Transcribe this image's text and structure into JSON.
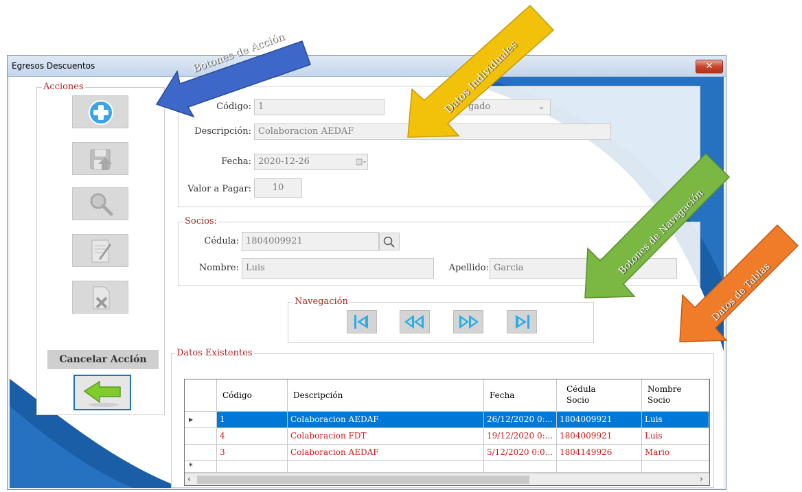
{
  "window": {
    "title": "Egresos Descuentos",
    "close_symbol": "✕"
  },
  "actions": {
    "legend": "Acciones",
    "cancel_label": "Cancelar Acción"
  },
  "form": {
    "codigo_label": "Código:",
    "codigo_value": "1",
    "estado_value": "gado",
    "descripcion_label": "Descripción:",
    "descripcion_value": "Colaboracion AEDAF",
    "fecha_label": "Fecha:",
    "fecha_value": "2020-12-26",
    "valor_label": "Valor a Pagar:",
    "valor_value": "10"
  },
  "socios": {
    "legend": "Socios:",
    "cedula_label": "Cédula:",
    "cedula_value": "1804009921",
    "nombre_label": "Nombre:",
    "nombre_value": "Luis",
    "apellido_label": "Apellido:",
    "apellido_value": "Garcia"
  },
  "navegacion": {
    "legend": "Navegación"
  },
  "datos": {
    "legend": "Datos Existentes",
    "columns": [
      "Código",
      "Descripción",
      "Fecha",
      "Cédula Socio",
      "Nombre Socio"
    ],
    "column_lines": [
      [
        "Código"
      ],
      [
        "Descripción"
      ],
      [
        "Fecha"
      ],
      [
        "Cédula",
        "Socio"
      ],
      [
        "Nombre",
        "Socio"
      ]
    ],
    "rows": [
      {
        "codigo": "1",
        "descripcion": "Colaboracion AEDAF",
        "fecha": "26/12/2020 0:...",
        "cedula": "1804009921",
        "nombre": "Luis"
      },
      {
        "codigo": "4",
        "descripcion": "Colaboracion FDT",
        "fecha": "19/12/2020 0:...",
        "cedula": "1804009921",
        "nombre": "Luis"
      },
      {
        "codigo": "3",
        "descripcion": "Colaboracion AEDAF",
        "fecha": "5/12/2020 0:0...",
        "cedula": "1804149926",
        "nombre": "Mario"
      }
    ],
    "new_row_marker": "*",
    "current_row_marker": "▸"
  },
  "annotations": [
    {
      "text": "Botones de Acción",
      "color": "#3d68c9"
    },
    {
      "text": "Datos Individuales",
      "color": "#f2c10a"
    },
    {
      "text": "Botones de Navegación",
      "color": "#7ab743"
    },
    {
      "text": "Datos de Tablas",
      "color": "#f07c2a"
    }
  ],
  "colors": {
    "accent_red": "#b22222",
    "selection_blue": "#0078d7",
    "swoosh_blue": "#1a5ea8"
  }
}
